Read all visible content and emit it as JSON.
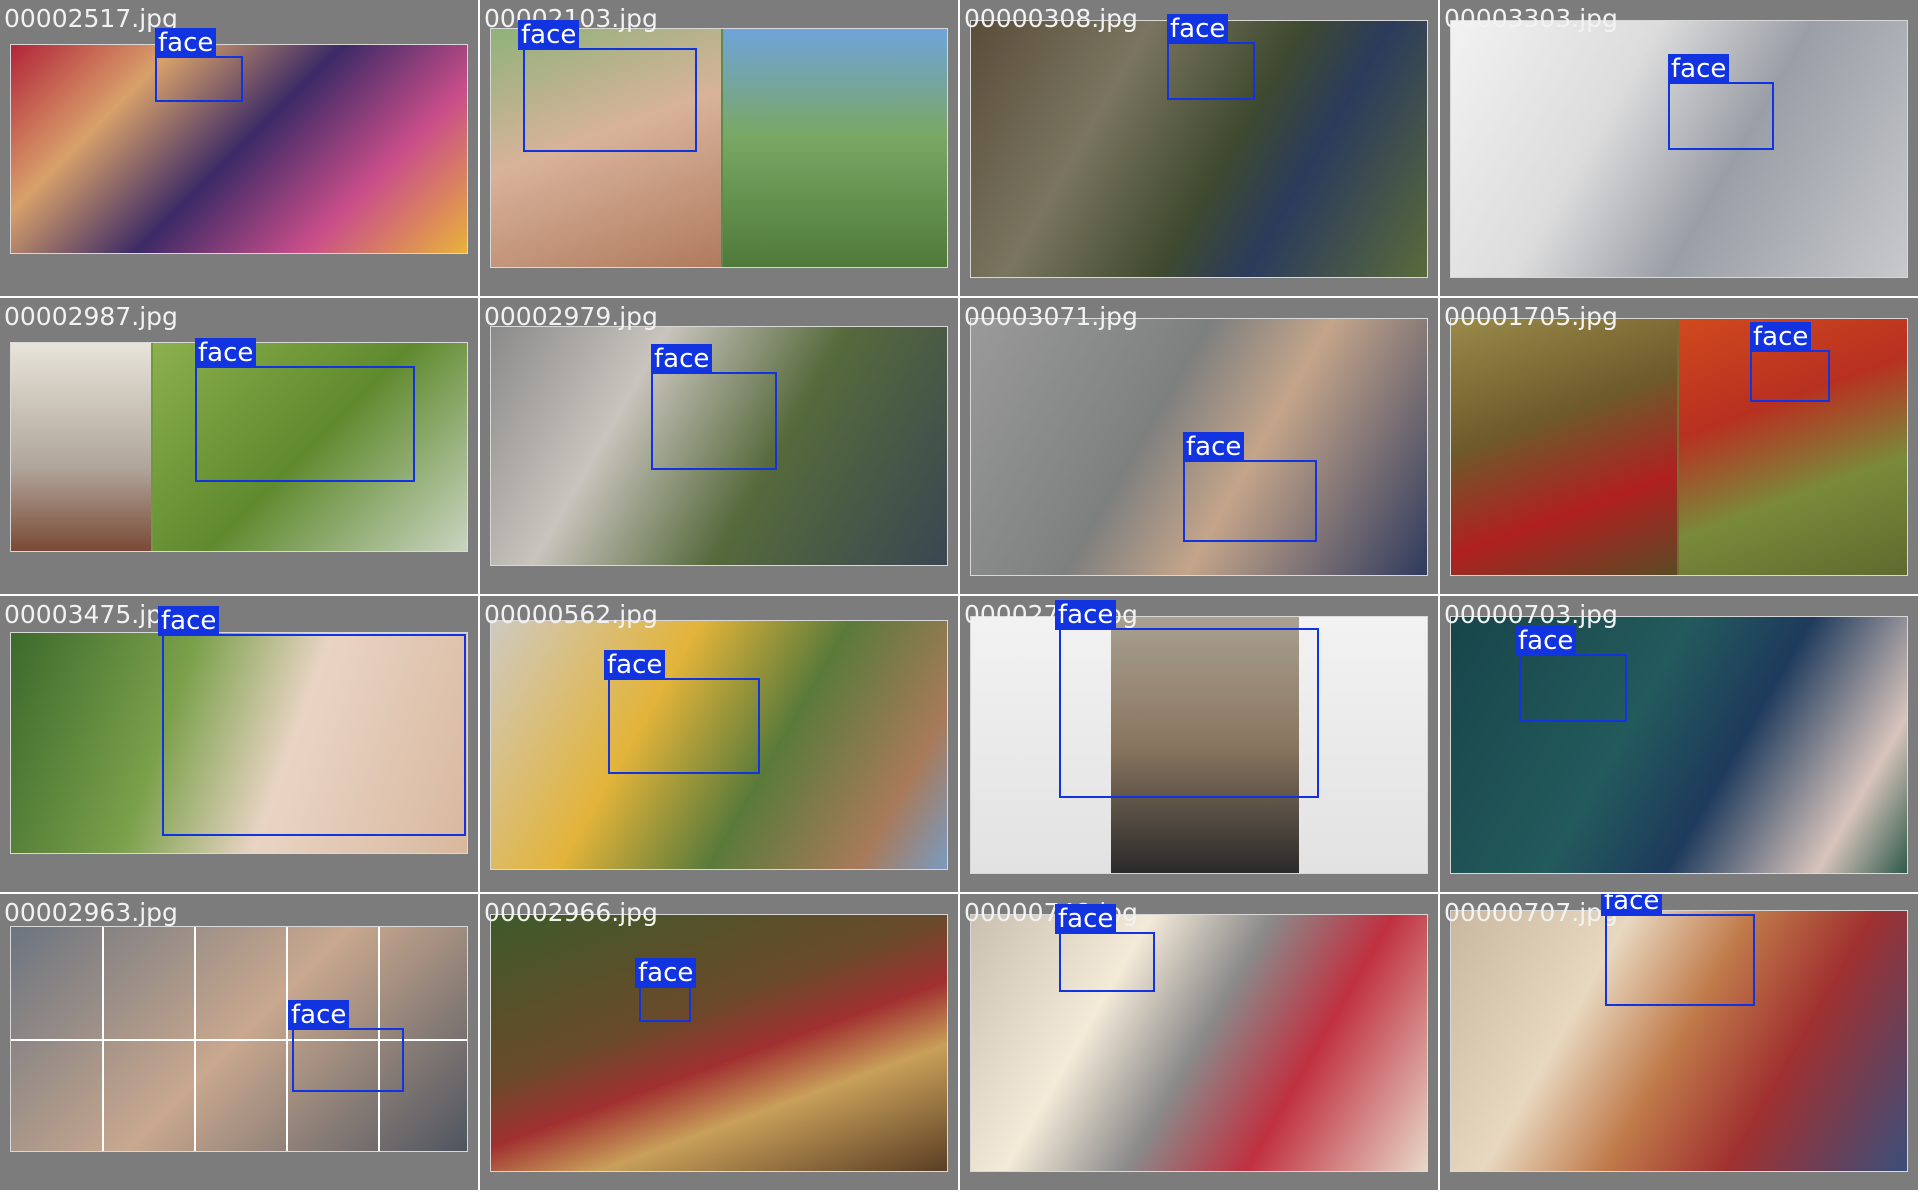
{
  "colors": {
    "tile_background": "#7c7c7c",
    "box_color": "#1133e0",
    "label_text": "#ffffff",
    "filename_text": "#f2f2f2"
  },
  "tiles": [
    {
      "filename": "00002517.jpg",
      "detections": [
        {
          "label": "face"
        }
      ]
    },
    {
      "filename": "00002103.jpg",
      "detections": [
        {
          "label": "face"
        }
      ]
    },
    {
      "filename": "00000308.jpg",
      "detections": [
        {
          "label": "face"
        }
      ]
    },
    {
      "filename": "00003303.jpg",
      "detections": [
        {
          "label": "face"
        }
      ]
    },
    {
      "filename": "00002987.jpg",
      "detections": [
        {
          "label": "face"
        }
      ]
    },
    {
      "filename": "00002979.jpg",
      "detections": [
        {
          "label": "face"
        }
      ]
    },
    {
      "filename": "00003071.jpg",
      "detections": [
        {
          "label": "face"
        }
      ]
    },
    {
      "filename": "00001705.jpg",
      "detections": [
        {
          "label": "face"
        }
      ]
    },
    {
      "filename": "00003475.jpg",
      "detections": [
        {
          "label": "face"
        }
      ]
    },
    {
      "filename": "00000562.jpg",
      "detections": [
        {
          "label": "face"
        }
      ]
    },
    {
      "filename": "00002742.jpg",
      "detections": [
        {
          "label": "face"
        }
      ]
    },
    {
      "filename": "00000703.jpg",
      "detections": [
        {
          "label": "face"
        }
      ]
    },
    {
      "filename": "00002963.jpg",
      "detections": [
        {
          "label": "face"
        }
      ]
    },
    {
      "filename": "00002966.jpg",
      "detections": [
        {
          "label": "face"
        }
      ]
    },
    {
      "filename": "00000748.jpg",
      "detections": [
        {
          "label": "face"
        }
      ]
    },
    {
      "filename": "00000707.jpg",
      "detections": [
        {
          "label": "face"
        }
      ]
    }
  ]
}
